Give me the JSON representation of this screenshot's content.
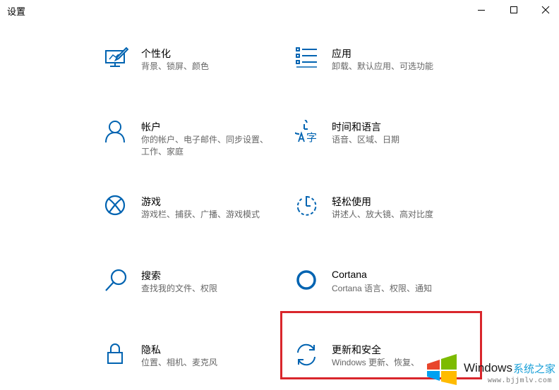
{
  "window": {
    "title": "设置"
  },
  "accent_color": "#0063b1",
  "highlight_color": "#d9262c",
  "tiles": [
    {
      "name": "个性化",
      "desc": "背景、锁屏、颜色",
      "icon": "personalization-icon"
    },
    {
      "name": "应用",
      "desc": "卸载、默认应用、可选功能",
      "icon": "apps-icon"
    },
    {
      "name": "帐户",
      "desc": "你的帐户、电子邮件、同步设置、工作、家庭",
      "icon": "account-icon"
    },
    {
      "name": "时间和语言",
      "desc": "语音、区域、日期",
      "icon": "time-language-icon"
    },
    {
      "name": "游戏",
      "desc": "游戏栏、捕获、广播、游戏模式",
      "icon": "xbox-icon"
    },
    {
      "name": "轻松使用",
      "desc": "讲述人、放大镜、高对比度",
      "icon": "ease-of-access-icon"
    },
    {
      "name": "搜索",
      "desc": "查找我的文件、权限",
      "icon": "search-icon"
    },
    {
      "name": "Cortana",
      "desc": "Cortana 语言、权限、通知",
      "icon": "cortana-icon"
    },
    {
      "name": "隐私",
      "desc": "位置、相机、麦克风",
      "icon": "lock-icon"
    },
    {
      "name": "更新和安全",
      "desc": "Windows 更新、恢复、",
      "icon": "update-icon"
    }
  ],
  "watermark": {
    "brand": "Windows",
    "site": "系统之家",
    "url": "www.bjjmlv.com"
  }
}
